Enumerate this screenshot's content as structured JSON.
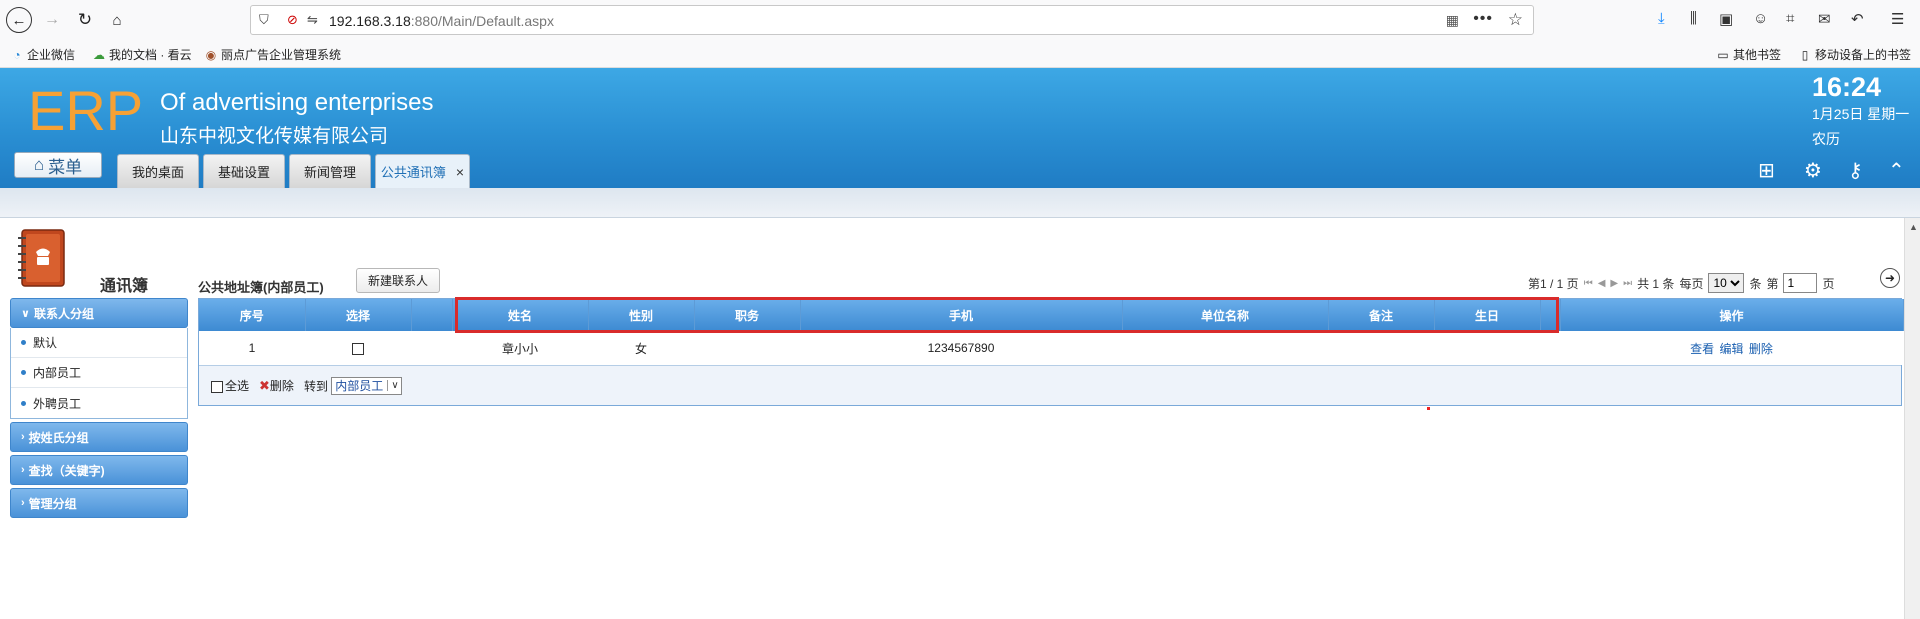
{
  "browser": {
    "url_host": "192.168.3.18",
    "url_rest": ":880/Main/Default.aspx",
    "bookmarks": [
      "企业微信",
      "我的文档 · 看云",
      "丽点广告企业管理系统"
    ],
    "bookmarks_right": [
      "其他书签",
      "移动设备上的书签"
    ]
  },
  "header": {
    "logo": "ERP",
    "title": "Of advertising enterprises",
    "company": "山东中视文化传媒有限公司",
    "menu_label": "菜单",
    "time": "16:24",
    "date": "1月25日 星期一",
    "lunar": "农历",
    "tabs": [
      {
        "label": "我的桌面"
      },
      {
        "label": "基础设置"
      },
      {
        "label": "新闻管理"
      },
      {
        "label": "公共通讯簿",
        "close": "×"
      }
    ]
  },
  "sidebar": {
    "title": "通讯簿",
    "sections": [
      {
        "label": "联系人分组",
        "items": [
          "默认",
          "内部员工",
          "外聘员工"
        ]
      },
      {
        "label": "按姓氏分组"
      },
      {
        "label": "查找（关键字)"
      },
      {
        "label": "管理分组"
      }
    ]
  },
  "main": {
    "list_title": "公共地址簿(内部员工)",
    "new_button": "新建联系人",
    "pager": {
      "page_info": "第1 / 1 页",
      "total": "共 1 条",
      "per_page_label": "每页",
      "per_page": "10",
      "unit": "条",
      "goto_prefix": "第",
      "page_input": "1",
      "goto_suffix": "页"
    },
    "columns": [
      "序号",
      "选择",
      "",
      "姓名",
      "性别",
      "职务",
      "手机",
      "单位名称",
      "备注",
      "生日",
      "",
      "操作"
    ],
    "rows": [
      {
        "no": "1",
        "name": "章小小",
        "gender": "女",
        "title": "",
        "mobile": "1234567890",
        "company": "",
        "note": "",
        "birthday": "",
        "actions": [
          "查看",
          "编辑",
          "删除"
        ]
      }
    ],
    "footer": {
      "select_all": "全选",
      "delete": "删除",
      "move_to": "转到",
      "target_group": "内部员工"
    }
  },
  "colors": {
    "header_blue": "#2a8fd3",
    "logo_orange": "#f6a135",
    "highlight_red": "#d92b2b"
  }
}
